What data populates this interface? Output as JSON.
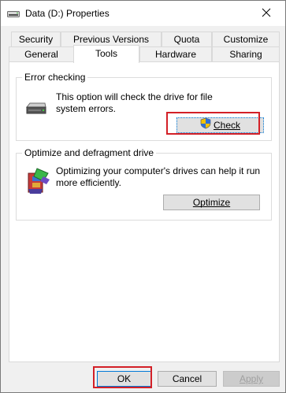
{
  "window": {
    "title": "Data (D:) Properties",
    "title_icon": "drive-icon",
    "close_icon": "close-icon"
  },
  "tabs": {
    "row1": [
      {
        "label": "Security"
      },
      {
        "label": "Previous Versions"
      },
      {
        "label": "Quota"
      },
      {
        "label": "Customize"
      }
    ],
    "row2": [
      {
        "label": "General"
      },
      {
        "label": "Tools",
        "active": true
      },
      {
        "label": "Hardware"
      },
      {
        "label": "Sharing"
      }
    ]
  },
  "error_checking": {
    "title": "Error checking",
    "icon": "hard-drive-icon",
    "description_line1": "This option will check the drive for file",
    "description_line2": "system errors.",
    "button_label": "Check",
    "button_icon": "uac-shield-icon"
  },
  "optimize": {
    "title": "Optimize and defragment drive",
    "icon": "defrag-icon",
    "description_line1": "Optimizing your computer's drives can help it run",
    "description_line2": "more efficiently.",
    "button_label": "Optimize"
  },
  "footer": {
    "ok_label": "OK",
    "cancel_label": "Cancel",
    "apply_label": "Apply"
  },
  "colors": {
    "highlight": "#d32027",
    "window_bg": "#f0f0f0",
    "panel_bg": "#ffffff"
  }
}
